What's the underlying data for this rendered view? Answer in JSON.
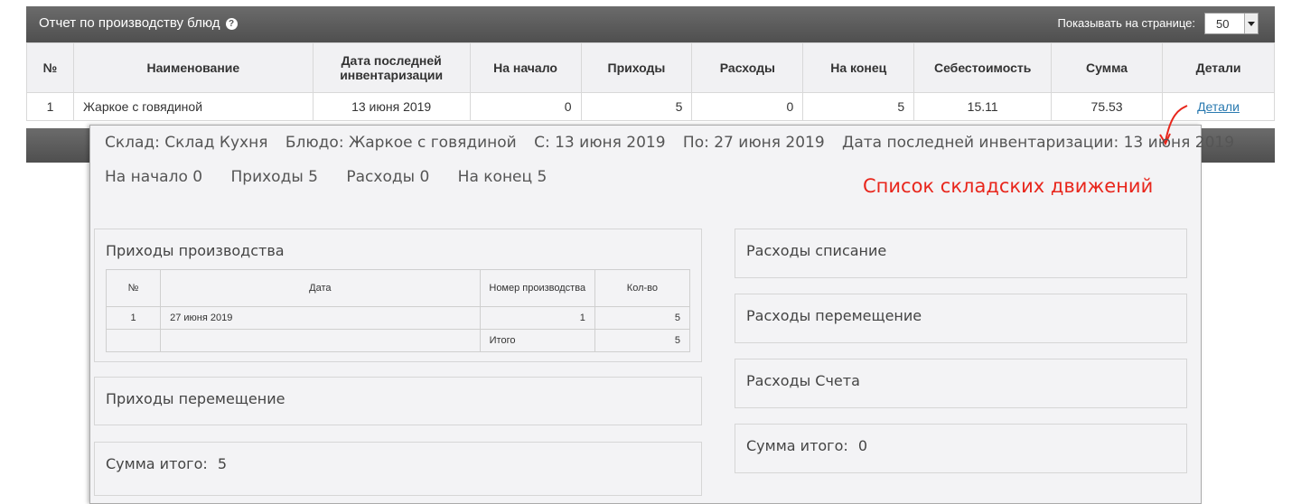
{
  "header": {
    "title": "Отчет по производству блюд",
    "help_icon": "question-circle-icon",
    "per_page_label": "Показывать на странице:",
    "per_page_value": "50"
  },
  "table": {
    "columns": [
      "№",
      "Наименование",
      "Дата последней инвентаризации",
      "На начало",
      "Приходы",
      "Расходы",
      "На конец",
      "Себестоимость",
      "Сумма",
      "Детали"
    ],
    "rows": [
      {
        "no": "1",
        "name": "Жаркое с говядиной",
        "inv_date": "13 июня 2019",
        "start": "0",
        "income": "5",
        "outcome": "0",
        "end": "5",
        "cost": "15.11",
        "sum": "75.53",
        "details": "Детали"
      }
    ]
  },
  "popup": {
    "line1": {
      "warehouse": "Склад: Склад Кухня",
      "dish": "Блюдо: Жаркое с говядиной",
      "from": "С: 13 июня 2019",
      "to": "По: 27 июня 2019",
      "last_inv": "Дата последней инвентаризации: 13 июня 2019"
    },
    "line2": {
      "start": "На начало 0",
      "income": "Приходы 5",
      "outcome": "Расходы 0",
      "end": "На конец 5"
    },
    "annotation": "Список складских движений",
    "annotation_color": "#e8261c",
    "left": {
      "production": {
        "title": "Приходы производства",
        "columns": [
          "№",
          "Дата",
          "Номер производства",
          "Кол-во"
        ],
        "rows": [
          {
            "no": "1",
            "date": "27 июня 2019",
            "prod_no": "1",
            "qty": "5"
          }
        ],
        "total_label": "Итого",
        "total_qty": "5"
      },
      "transfer_title": "Приходы перемещение",
      "sum_label": "Сумма итого:",
      "sum_value": "5"
    },
    "right": {
      "writeoff_title": "Расходы списание",
      "transfer_title": "Расходы перемещение",
      "invoices_title": "Расходы Счета",
      "sum_label": "Сумма итого:",
      "sum_value": "0"
    }
  }
}
